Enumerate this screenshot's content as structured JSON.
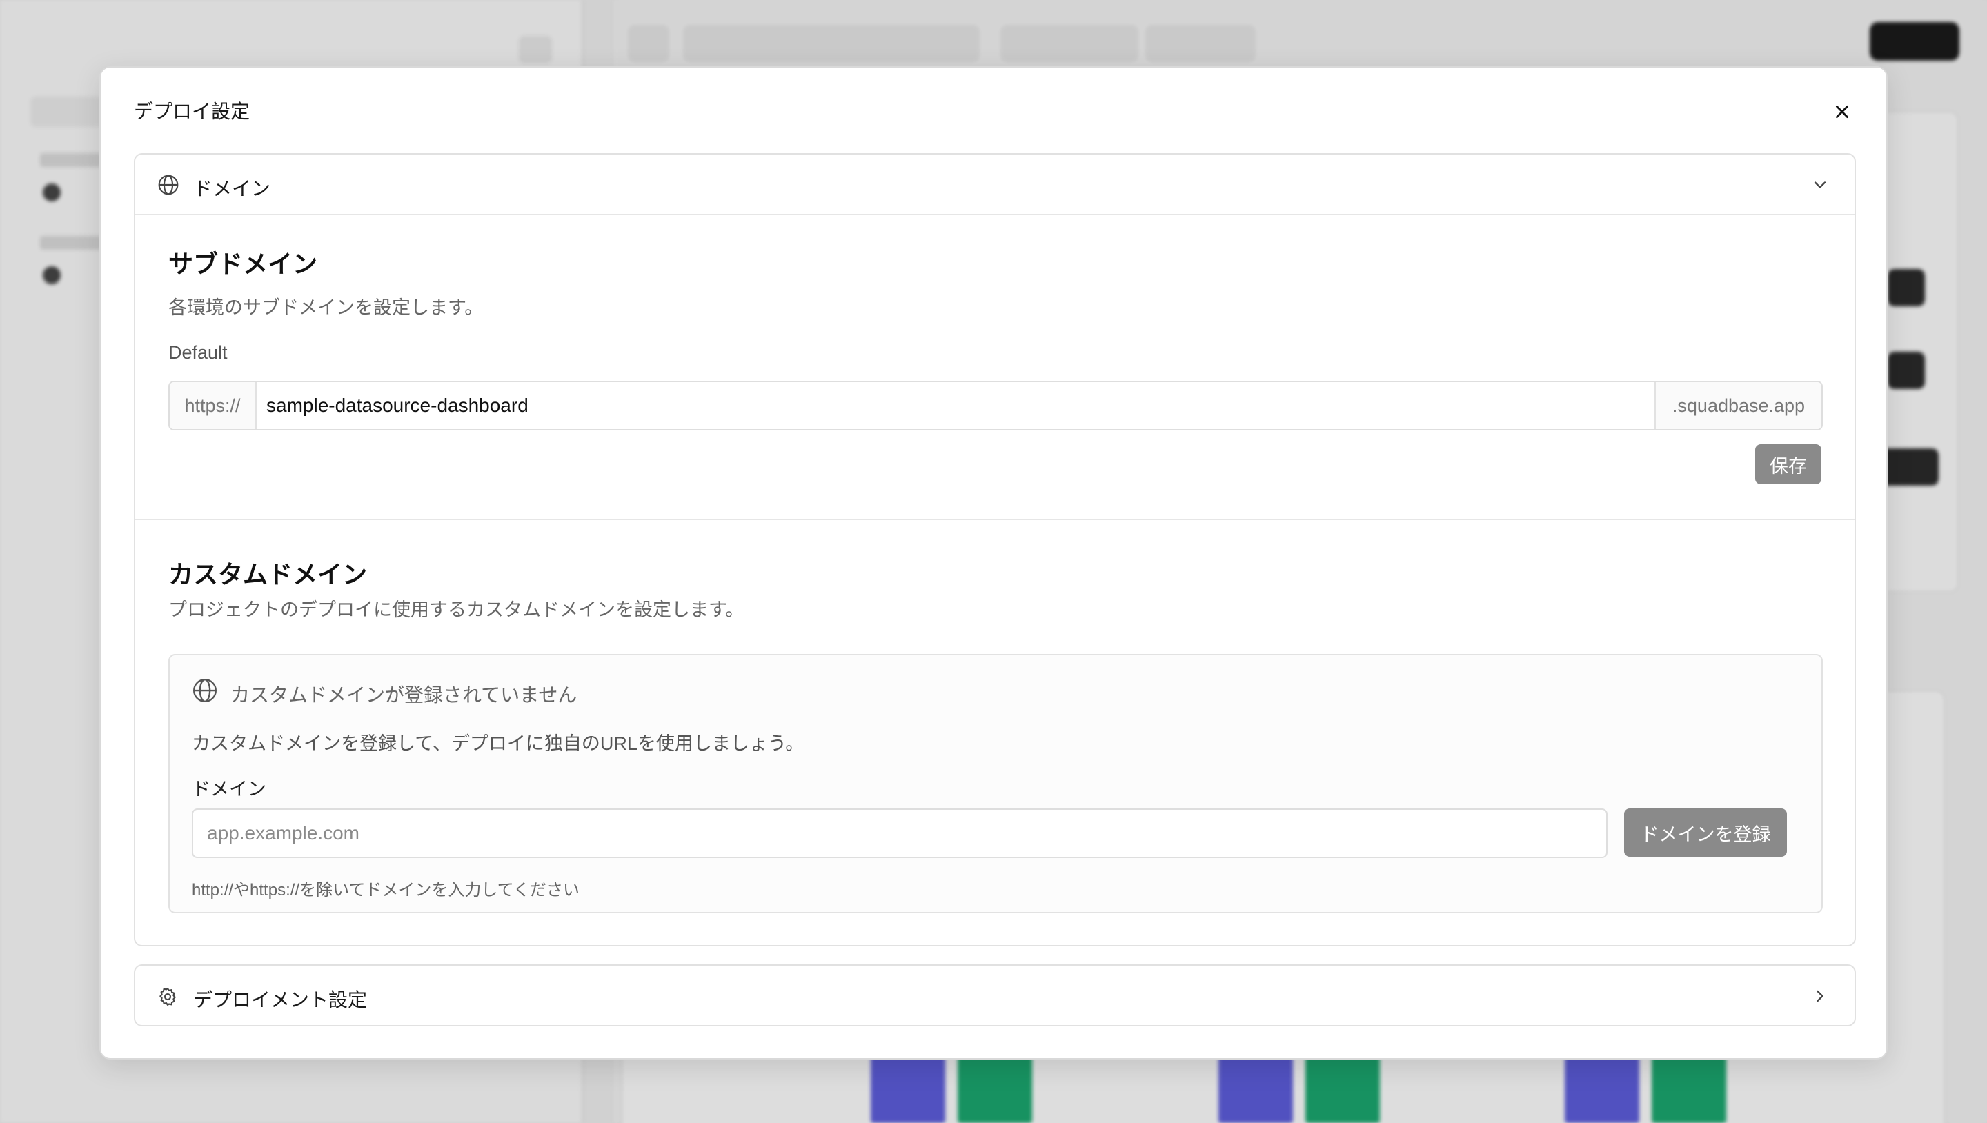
{
  "dialog": {
    "title": "デプロイ設定",
    "close_icon": "close-icon"
  },
  "domain_section": {
    "header_label": "ドメイン",
    "header_icon": "globe-icon",
    "expanded": true,
    "subdomain": {
      "heading": "サブドメイン",
      "description": "各環境のサブドメインを設定します。",
      "env_label": "Default",
      "prefix": "https://",
      "value": "sample-datasource-dashboard",
      "suffix": ".squadbase.app",
      "save_label": "保存"
    },
    "custom_domain": {
      "heading": "カスタムドメイン",
      "description": "プロジェクトのデプロイに使用するカスタムドメインを設定します。",
      "empty_title": "カスタムドメインが登録されていません",
      "empty_description": "カスタムドメインを登録して、デプロイに独自のURLを使用しましょう。",
      "field_label": "ドメイン",
      "placeholder": "app.example.com",
      "register_label": "ドメインを登録",
      "hint": "http://やhttps://を除いてドメインを入力してください"
    }
  },
  "deployment_section": {
    "header_label": "デプロイメント設定",
    "header_icon": "gear-icon",
    "expanded": false
  },
  "colors": {
    "disabled_button": "#8a8a8a",
    "border": "#e1e1e1",
    "muted_text": "#666666"
  }
}
